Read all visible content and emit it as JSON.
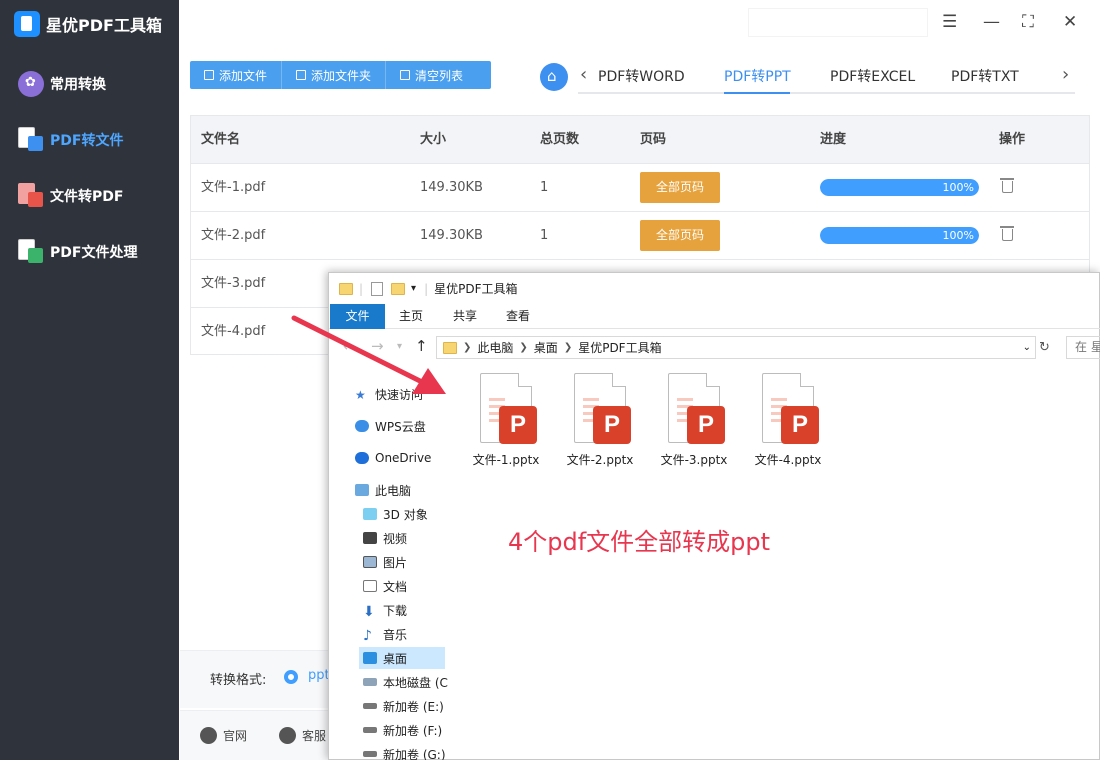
{
  "app": {
    "title": "星优PDF工具箱"
  },
  "sidebar": {
    "items": [
      {
        "label": "常用转换",
        "icon": "flower-grid-icon",
        "active": false
      },
      {
        "label": "PDF转文件",
        "icon": "pdf-to-file-icon",
        "active": true
      },
      {
        "label": "文件转PDF",
        "icon": "file-to-pdf-icon",
        "active": false
      },
      {
        "label": "PDF文件处理",
        "icon": "pdf-process-icon",
        "active": false
      }
    ]
  },
  "toolbar": {
    "add_file": "添加文件",
    "add_folder": "添加文件夹",
    "clear_list": "清空列表"
  },
  "tabs": {
    "items": [
      "PDF转WORD",
      "PDF转PPT",
      "PDF转EXCEL",
      "PDF转TXT"
    ],
    "active": "PDF转PPT"
  },
  "table": {
    "headers": {
      "name": "文件名",
      "size": "大小",
      "pages": "总页数",
      "range": "页码",
      "progress": "进度",
      "action": "操作"
    },
    "rows": [
      {
        "name": "文件-1.pdf",
        "size": "149.30KB",
        "pages": "1",
        "range_button": "全部页码",
        "progress_text": "100%",
        "progress": 1.0
      },
      {
        "name": "文件-2.pdf",
        "size": "149.30KB",
        "pages": "1",
        "range_button": "全部页码",
        "progress_text": "100%",
        "progress": 1.0
      },
      {
        "name": "文件-3.pdf"
      },
      {
        "name": "文件-4.pdf"
      }
    ]
  },
  "bottom": {
    "format_label": "转换格式:",
    "format_option": "ppt",
    "footer_links": [
      "官网",
      "客服"
    ]
  },
  "explorer": {
    "title": "星优PDF工具箱",
    "ribbon_tabs": [
      "文件",
      "主页",
      "共享",
      "查看"
    ],
    "breadcrumb": [
      "此电脑",
      "桌面",
      "星优PDF工具箱"
    ],
    "search_placeholder": "在 星",
    "nav_items": [
      {
        "label": "快速访问",
        "icon": "star-icon"
      },
      {
        "label": "WPS云盘",
        "icon": "cloud-icon"
      },
      {
        "label": "OneDrive",
        "icon": "onedrive-icon"
      },
      {
        "label": "此电脑",
        "icon": "computer-icon"
      },
      {
        "label": "3D 对象",
        "icon": "cube-icon"
      },
      {
        "label": "视频",
        "icon": "video-icon"
      },
      {
        "label": "图片",
        "icon": "picture-icon"
      },
      {
        "label": "文档",
        "icon": "document-icon"
      },
      {
        "label": "下载",
        "icon": "download-icon"
      },
      {
        "label": "音乐",
        "icon": "music-icon"
      },
      {
        "label": "桌面",
        "icon": "desktop-icon",
        "selected": true
      },
      {
        "label": "本地磁盘 (C",
        "icon": "disk-icon"
      },
      {
        "label": "新加卷 (E:)",
        "icon": "drive-icon"
      },
      {
        "label": "新加卷 (F:)",
        "icon": "drive-icon"
      },
      {
        "label": "新加卷 (G:)",
        "icon": "drive-icon"
      }
    ],
    "files": [
      "文件-1.pptx",
      "文件-2.pptx",
      "文件-3.pptx",
      "文件-4.pptx"
    ],
    "file_badge": "P"
  },
  "annotation": "4个pdf文件全部转成ppt",
  "colors": {
    "sidebar_bg": "#2f333c",
    "accent": "#409eff",
    "orange_button": "#e6a23c",
    "annotation_red": "#e8364f",
    "ppt_red": "#d9412b"
  }
}
